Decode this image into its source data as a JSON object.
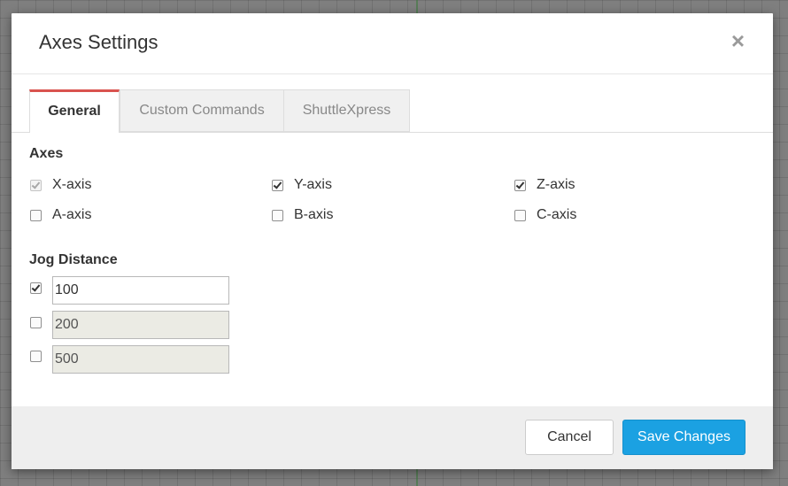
{
  "dialog": {
    "title": "Axes Settings",
    "close_label": "×"
  },
  "tabs": [
    {
      "label": "General",
      "active": true
    },
    {
      "label": "Custom Commands",
      "active": false
    },
    {
      "label": "ShuttleXpress",
      "active": false
    }
  ],
  "axes": {
    "title": "Axes",
    "items": [
      {
        "label": "X-axis",
        "checked": true,
        "disabled": true
      },
      {
        "label": "Y-axis",
        "checked": true,
        "disabled": false
      },
      {
        "label": "Z-axis",
        "checked": true,
        "disabled": false
      },
      {
        "label": "A-axis",
        "checked": false,
        "disabled": false
      },
      {
        "label": "B-axis",
        "checked": false,
        "disabled": false
      },
      {
        "label": "C-axis",
        "checked": false,
        "disabled": false
      }
    ]
  },
  "jog": {
    "title": "Jog Distance",
    "items": [
      {
        "value": "100",
        "checked": true,
        "disabled": false
      },
      {
        "value": "200",
        "checked": false,
        "disabled": true
      },
      {
        "value": "500",
        "checked": false,
        "disabled": true
      }
    ]
  },
  "footer": {
    "cancel_label": "Cancel",
    "save_label": "Save Changes"
  },
  "colors": {
    "active_tab_accent": "#d9534f",
    "primary_button": "#1ba1e2"
  }
}
